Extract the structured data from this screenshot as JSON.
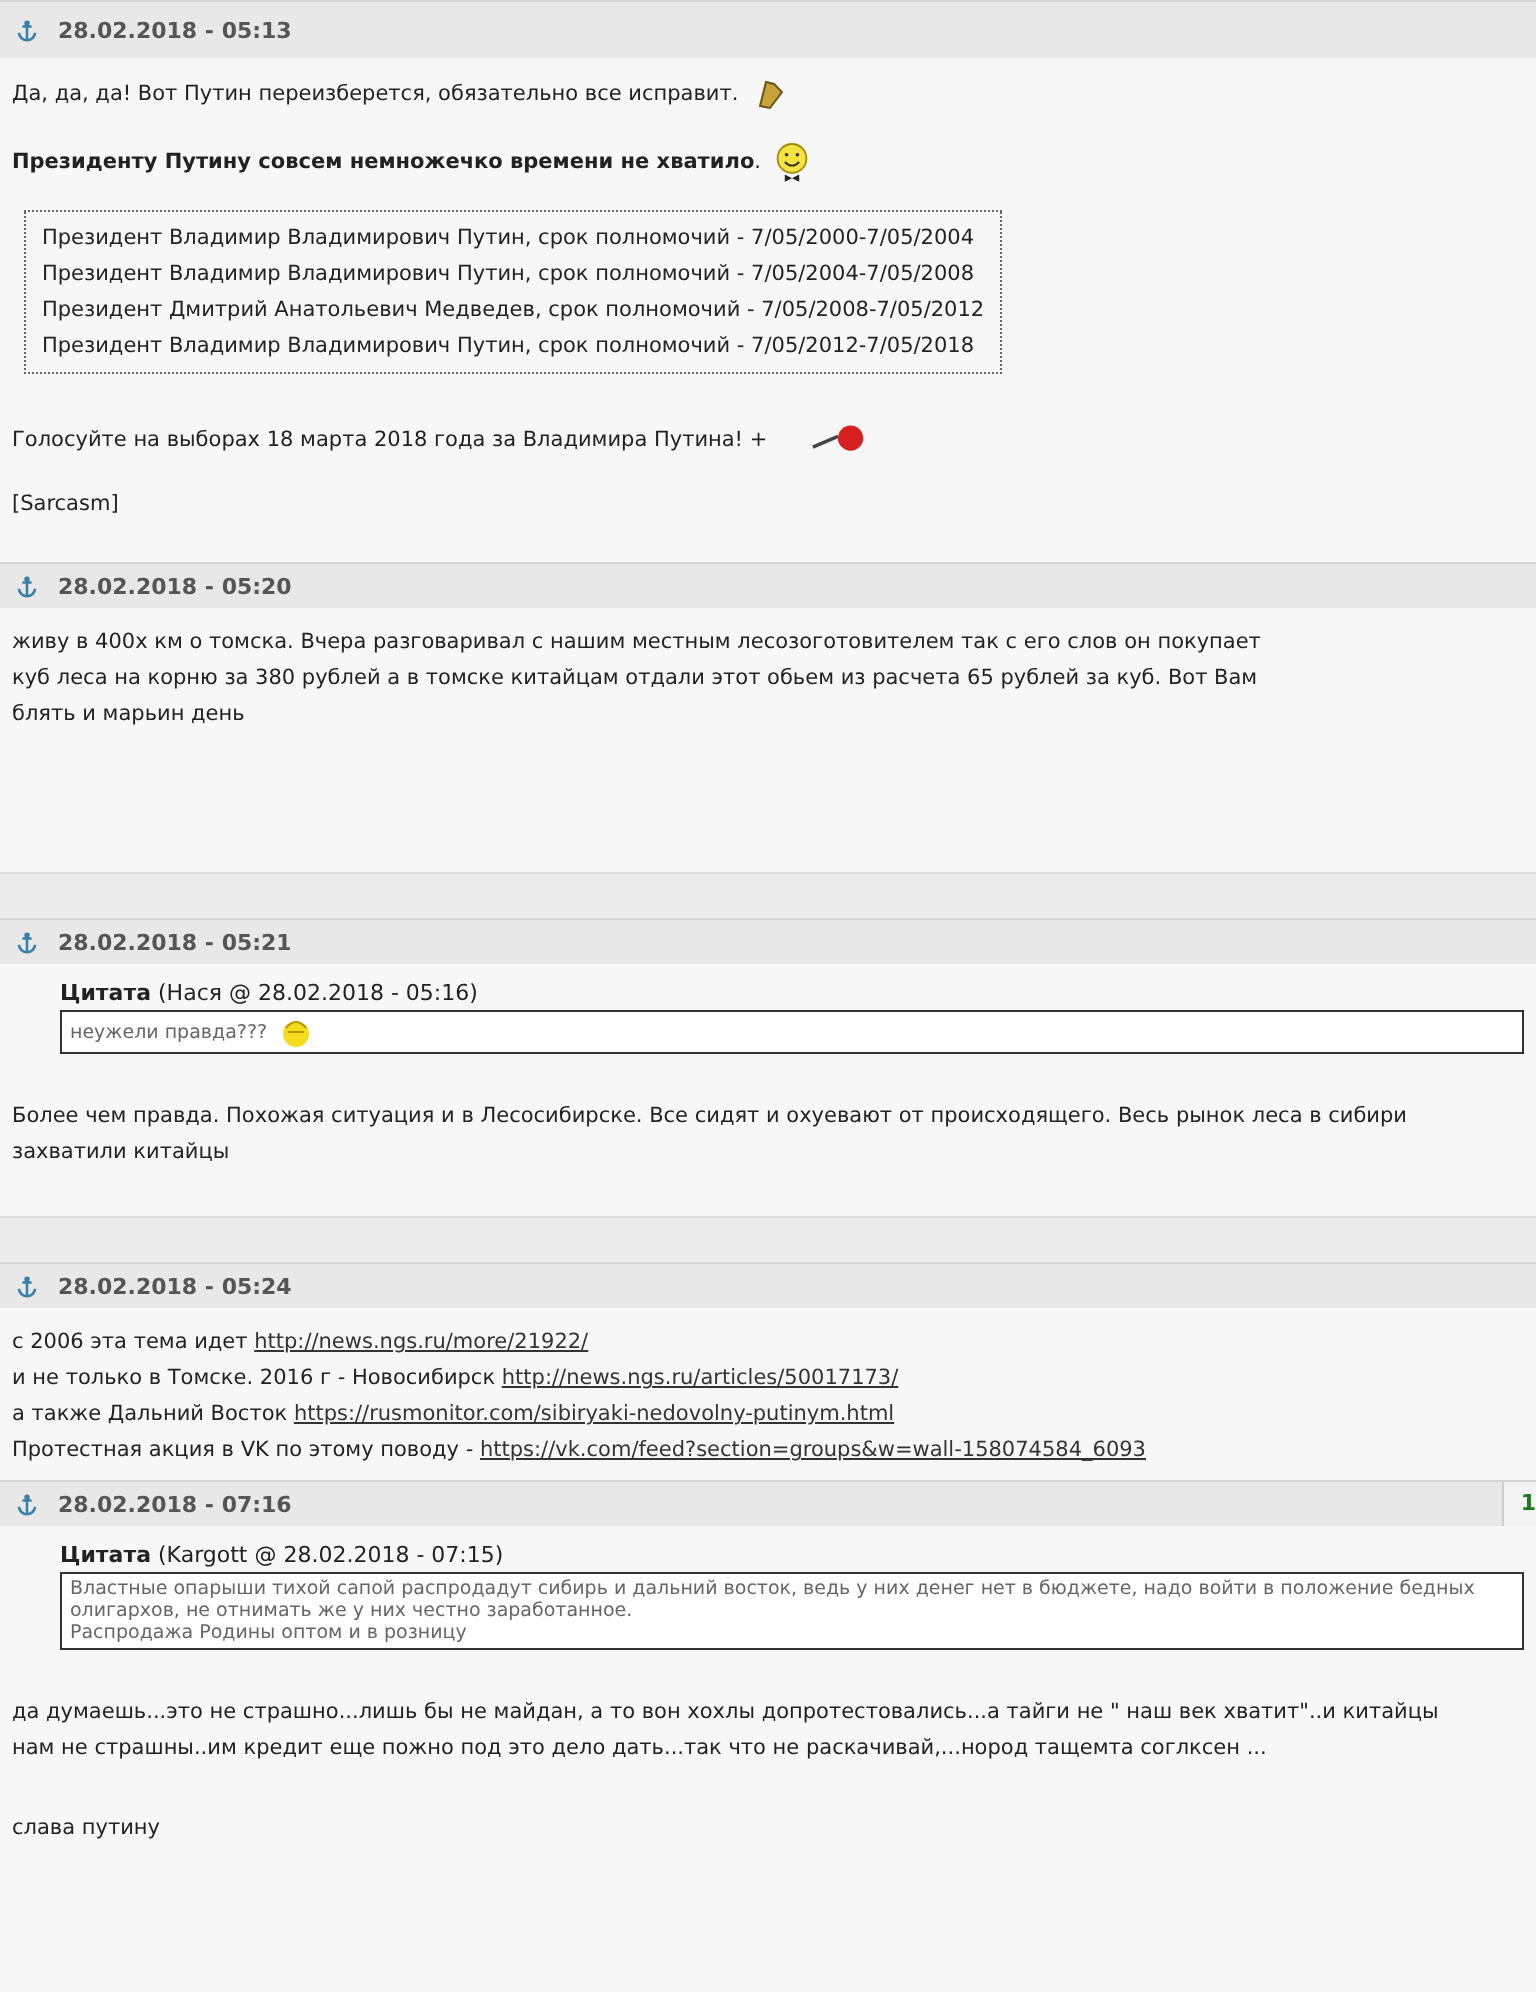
{
  "posts": [
    {
      "date": "28.02.2018 - 05:13",
      "blocks": [
        {
          "kind": "text",
          "text": "Да, да, да! Вот Путин переизберется, обязательно все исправит."
        },
        {
          "kind": "bold",
          "text": "Президенту Путину совсем немножечко времени не хватило",
          "tail": "."
        },
        {
          "kind": "list",
          "lines": [
            "Президент Владимир Владимирович Путин, срок полномочий - 7/05/2000-7/05/2004",
            "Президент Владимир Владимирович Путин, срок полномочий - 7/05/2004-7/05/2008",
            "Президент Дмитрий Анатольевич Медведев, срок полномочий - 7/05/2008-7/05/2012",
            "Президент Владимир Владимирович Путин, срок полномочий - 7/05/2012-7/05/2018"
          ]
        },
        {
          "kind": "text",
          "text": "Голосуйте на выборах 18 марта 2018 года за Владимира Путина! +"
        },
        {
          "kind": "text",
          "text": "[Sarcasm]"
        }
      ]
    },
    {
      "date": "28.02.2018 - 05:20",
      "spacer": true,
      "blocks": [
        {
          "kind": "text",
          "text": "живу в 400х км о томска. Вчера разговаривал с нашим местным лесозоготовителем так с его слов он покупает куб леса на корню за 380 рублей а в томске китайцам отдали этот обьем из расчета 65 рублей за куб. Вот Вам блять и марьин день"
        }
      ]
    },
    {
      "date": "28.02.2018 - 05:21",
      "spacer": true,
      "quote": {
        "label": "Цитата",
        "source": "(Нася @ 28.02.2018 - 05:16)",
        "text": "неужели правда???"
      },
      "blocks": [
        {
          "kind": "text",
          "text": "Более чем правда. Похожая ситуация и в Лесосибирске. Все сидят и охуевают от происходящего. Весь рынок леса в сибири захватили китайцы"
        }
      ]
    },
    {
      "date": "28.02.2018 - 05:24",
      "blocks": [
        {
          "kind": "links",
          "lines": [
            {
              "text": "с 2006 эта тема идет",
              "url": "http://news.ngs.ru/more/21922/"
            },
            {
              "text": "и не только в Томске. 2016 г - Новосибирск",
              "url": "http://news.ngs.ru/articles/50017173/"
            },
            {
              "text": "а также Дальний Восток",
              "url": "https://rusmonitor.com/sibiryaki-nedovolny-putinym.html"
            },
            {
              "text": "Протестная акция в VK по этому поводу -",
              "url": "https://vk.com/feed?section=groups&w=wall-158074584_6093"
            }
          ]
        }
      ]
    },
    {
      "date": "28.02.2018 - 07:16",
      "number": "1",
      "quote": {
        "label": "Цитата",
        "source": "(Kargott @ 28.02.2018 - 07:15)",
        "text": "Властные опарыши тихой сапой распродадут сибирь и дальний восток, ведь у них денег нет в бюджете, надо войти в положение бедных олигархов, не отнимать же у них честно заработанное.\nРаспродажа Родины оптом и в розницу"
      },
      "blocks": [
        {
          "kind": "text",
          "text": "да думаешь...это не страшно...лишь бы не майдан, а то вон хохлы допротестовались...а тайги не \" наш век хватит\"..и китайцы нам не страшны..им кредит еще пожно под это дело дать...так что не раскачивай,...нород тащемта соглксен ..."
        },
        {
          "kind": "text",
          "text": "слава путину"
        }
      ]
    }
  ]
}
